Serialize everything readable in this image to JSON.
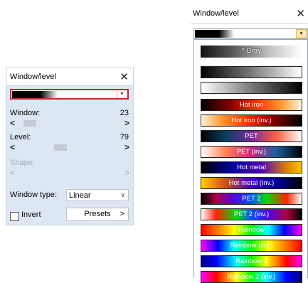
{
  "left_panel": {
    "title": "Window/level",
    "close_glyph": "✕",
    "window_label": "Window:",
    "window_value": "23",
    "window_fraction": 0.11,
    "level_label": "Level:",
    "level_value": "79",
    "level_fraction": 0.41,
    "shape_label": "Shape:",
    "arrow_left": "<",
    "arrow_right": ">",
    "window_type_label": "Window type:",
    "window_type_value": "Linear",
    "invert_label": "Invert",
    "presets_label": "Presets",
    "presets_arrow": ">"
  },
  "right_panel": {
    "title": "Window/level",
    "close_glyph": "✕",
    "colormaps": [
      {
        "label": "* Gray",
        "text_color": "#ffffff"
      },
      {
        "label": "",
        "text_color": "#ffffff"
      },
      {
        "label": "",
        "text_color": "#ffffff"
      },
      {
        "label": "Hot iron",
        "text_color": "#ffffff"
      },
      {
        "label": "Hot iron (inv.)",
        "text_color": "#ffffff"
      },
      {
        "label": "PET",
        "text_color": "#ffffff"
      },
      {
        "label": "PET (inv.)",
        "text_color": "#ffffff"
      },
      {
        "label": "Hot metal",
        "text_color": "#ffffff"
      },
      {
        "label": "Hot metal (inv.)",
        "text_color": "#ffffff"
      },
      {
        "label": "PET 2",
        "text_color": "#ffffff"
      },
      {
        "label": "PET 2 (inv.)",
        "text_color": "#ffffff"
      },
      {
        "label": "Rainbow",
        "text_color": "#ffffff"
      },
      {
        "label": "Rainbow (inv.)",
        "text_color": "#ffffff"
      },
      {
        "label": "Rainbow 2",
        "text_color": "#ffffff"
      },
      {
        "label": "Rainbow 2 (inv.)",
        "text_color": "#ffffff"
      }
    ]
  },
  "colors": {
    "panel_bg": "#dde7f3",
    "focus_border": "#c0282d",
    "dropdown_arrow_highlight": "#ffe8a6"
  }
}
